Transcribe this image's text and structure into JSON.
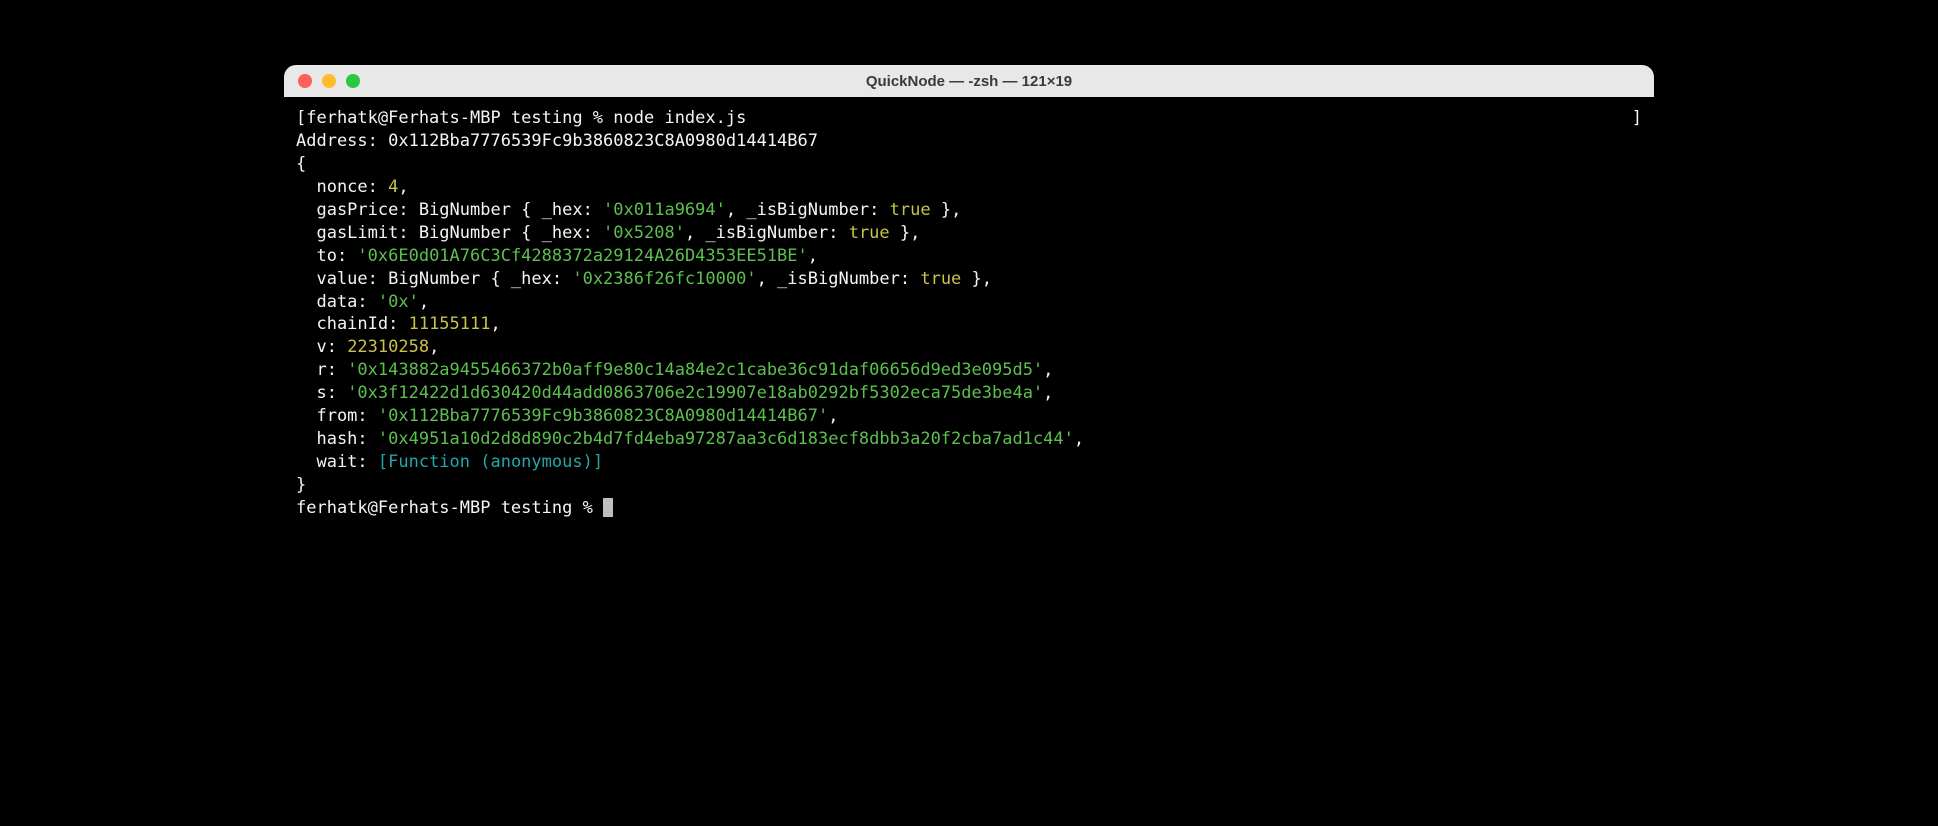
{
  "window": {
    "title": "QuickNode — -zsh — 121×19"
  },
  "prompt": {
    "line1_prefix": "[ferhatk@Ferhats-MBP testing % ",
    "command": "node index.js",
    "line2": "ferhatk@Ferhats-MBP testing % "
  },
  "output": {
    "addressLabel": "Address: ",
    "addressValue": "0x112Bba7776539Fc9b3860823C8A0980d14414B67",
    "openBrace": "{",
    "closeBrace": "}",
    "nonceKey": "  nonce: ",
    "nonceVal": "4",
    "comma": ",",
    "gasPricePrefix": "  gasPrice: BigNumber { _hex: ",
    "gasPriceHex": "'0x011a9694'",
    "isBigNumKey": ", _isBigNumber: ",
    "trueVal": "true",
    "bigNumSuffix": " },",
    "gasLimitPrefix": "  gasLimit: BigNumber { _hex: ",
    "gasLimitHex": "'0x5208'",
    "toKey": "  to: ",
    "toVal": "'0x6E0d01A76C3Cf4288372a29124A26D4353EE51BE'",
    "valuePrefix": "  value: BigNumber { _hex: ",
    "valueHex": "'0x2386f26fc10000'",
    "dataKey": "  data: ",
    "dataVal": "'0x'",
    "chainIdKey": "  chainId: ",
    "chainIdVal": "11155111",
    "vKey": "  v: ",
    "vVal": "22310258",
    "rKey": "  r: ",
    "rVal": "'0x143882a9455466372b0aff9e80c14a84e2c1cabe36c91daf06656d9ed3e095d5'",
    "sKey": "  s: ",
    "sVal": "'0x3f12422d1d630420d44add0863706e2c19907e18ab0292bf5302eca75de3be4a'",
    "fromKey": "  from: ",
    "fromVal": "'0x112Bba7776539Fc9b3860823C8A0980d14414B67'",
    "hashKey": "  hash: ",
    "hashVal": "'0x4951a10d2d8d890c2b4d7fd4eba97287aa3c6d183ecf8dbb3a20f2cba7ad1c44'",
    "waitKey": "  wait: ",
    "waitVal": "[Function (anonymous)]",
    "rbracket": "]"
  }
}
